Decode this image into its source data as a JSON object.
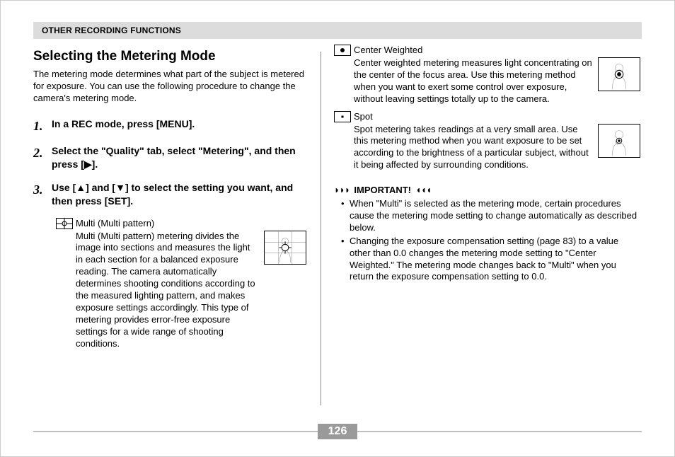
{
  "header": {
    "title": "OTHER RECORDING FUNCTIONS"
  },
  "section": {
    "title": "Selecting the Metering Mode",
    "intro": "The metering mode determines what part of the subject is metered for exposure. You can use the following procedure to change the camera's metering mode."
  },
  "steps": [
    "In a REC mode, press [MENU].",
    "Select the \"Quality\" tab, select \"Metering\", and then press [▶].",
    "Use [▲] and [▼] to select the setting you want, and then press [SET]."
  ],
  "modes": {
    "multi": {
      "label": "Multi (Multi pattern)",
      "desc": "Multi (Multi pattern) metering divides the image into sections and measures the light in each section for a balanced exposure reading. The camera automatically determines shooting conditions according to the measured lighting pattern, and makes exposure settings accordingly. This type of metering provides error-free exposure settings for a wide range of shooting conditions."
    },
    "center": {
      "label": "Center Weighted",
      "desc": "Center weighted metering measures light concentrating on the center of the focus area. Use this metering method when you want to exert some control over exposure, without leaving settings totally up to the camera."
    },
    "spot": {
      "label": "Spot",
      "desc": "Spot metering takes readings at a very small area. Use this metering method when you want exposure to be set according to the brightness of a particular subject, without it being affected by surrounding conditions."
    }
  },
  "important": {
    "label": "IMPORTANT!",
    "bullets": [
      "When \"Multi\" is selected as the metering mode, certain procedures cause the metering mode setting to change automatically as described below.",
      "Changing the exposure compensation setting (page 83) to a value other than 0.0 changes the metering mode setting to \"Center Weighted.\" The metering mode changes back to \"Multi\" when you return the exposure compensation setting to 0.0."
    ]
  },
  "page_number": "126"
}
